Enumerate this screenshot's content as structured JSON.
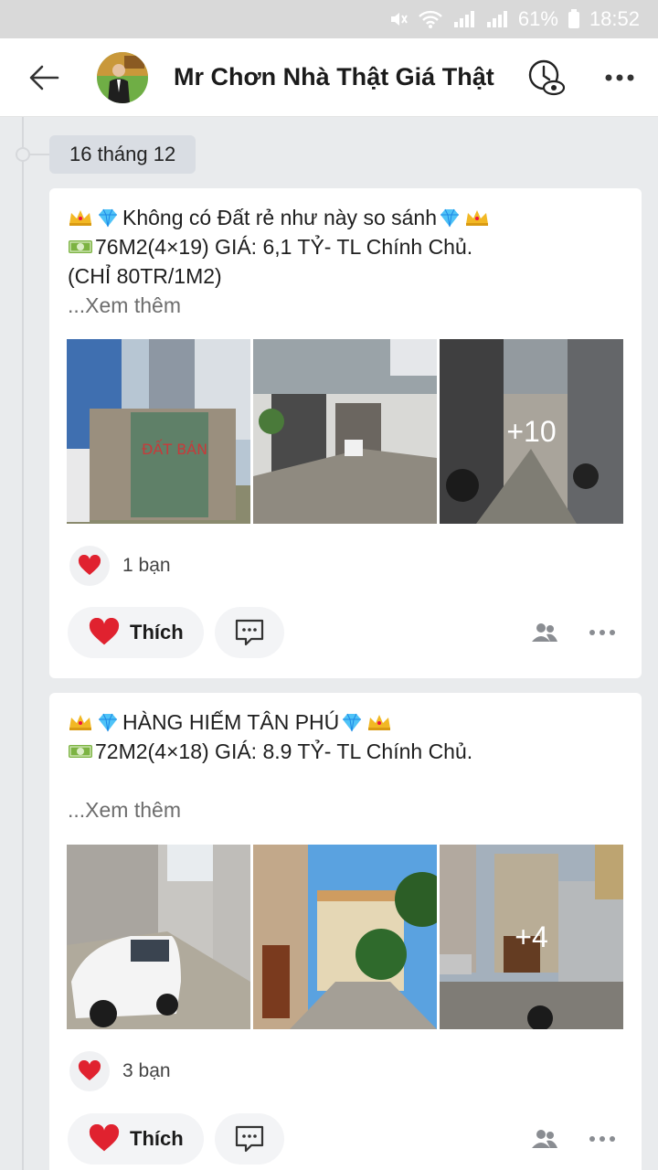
{
  "status": {
    "battery": "61%",
    "time": "18:52"
  },
  "header": {
    "title": "Mr Chơn Nhà Thật Giá Thật"
  },
  "timeline": {
    "date": "16 tháng 12"
  },
  "posts": [
    {
      "line1": "Không có Đất rẻ như này so sánh",
      "line2": "76M2(4×19) GIÁ: 6,1 TỶ- TL Chính Chủ.",
      "line3": "(CHỈ 80TR/1M2)",
      "see_more": "...Xem thêm",
      "more_photos": "+10",
      "reaction_count": "1 bạn",
      "like_label": "Thích"
    },
    {
      "line1": "HÀNG HIẾM TÂN PHÚ",
      "line2": "72M2(4×18) GIÁ: 8.9 TỶ- TL Chính Chủ.",
      "line3": "",
      "see_more": "...Xem thêm",
      "more_photos": "+4",
      "reaction_count": "3 bạn",
      "like_label": "Thích"
    }
  ],
  "icons": {
    "back": "arrow-left-icon",
    "history": "clock-eye-icon",
    "more": "more-dots-icon",
    "crown": "crown-emoji",
    "diamond": "diamond-emoji",
    "money": "dollar-banknote-emoji",
    "heart": "heart-icon",
    "comment": "comment-bubble-icon",
    "people": "people-icon"
  },
  "colors": {
    "heart": "#e0222f",
    "appbar": "#ffffff",
    "background": "#e9ebed"
  }
}
